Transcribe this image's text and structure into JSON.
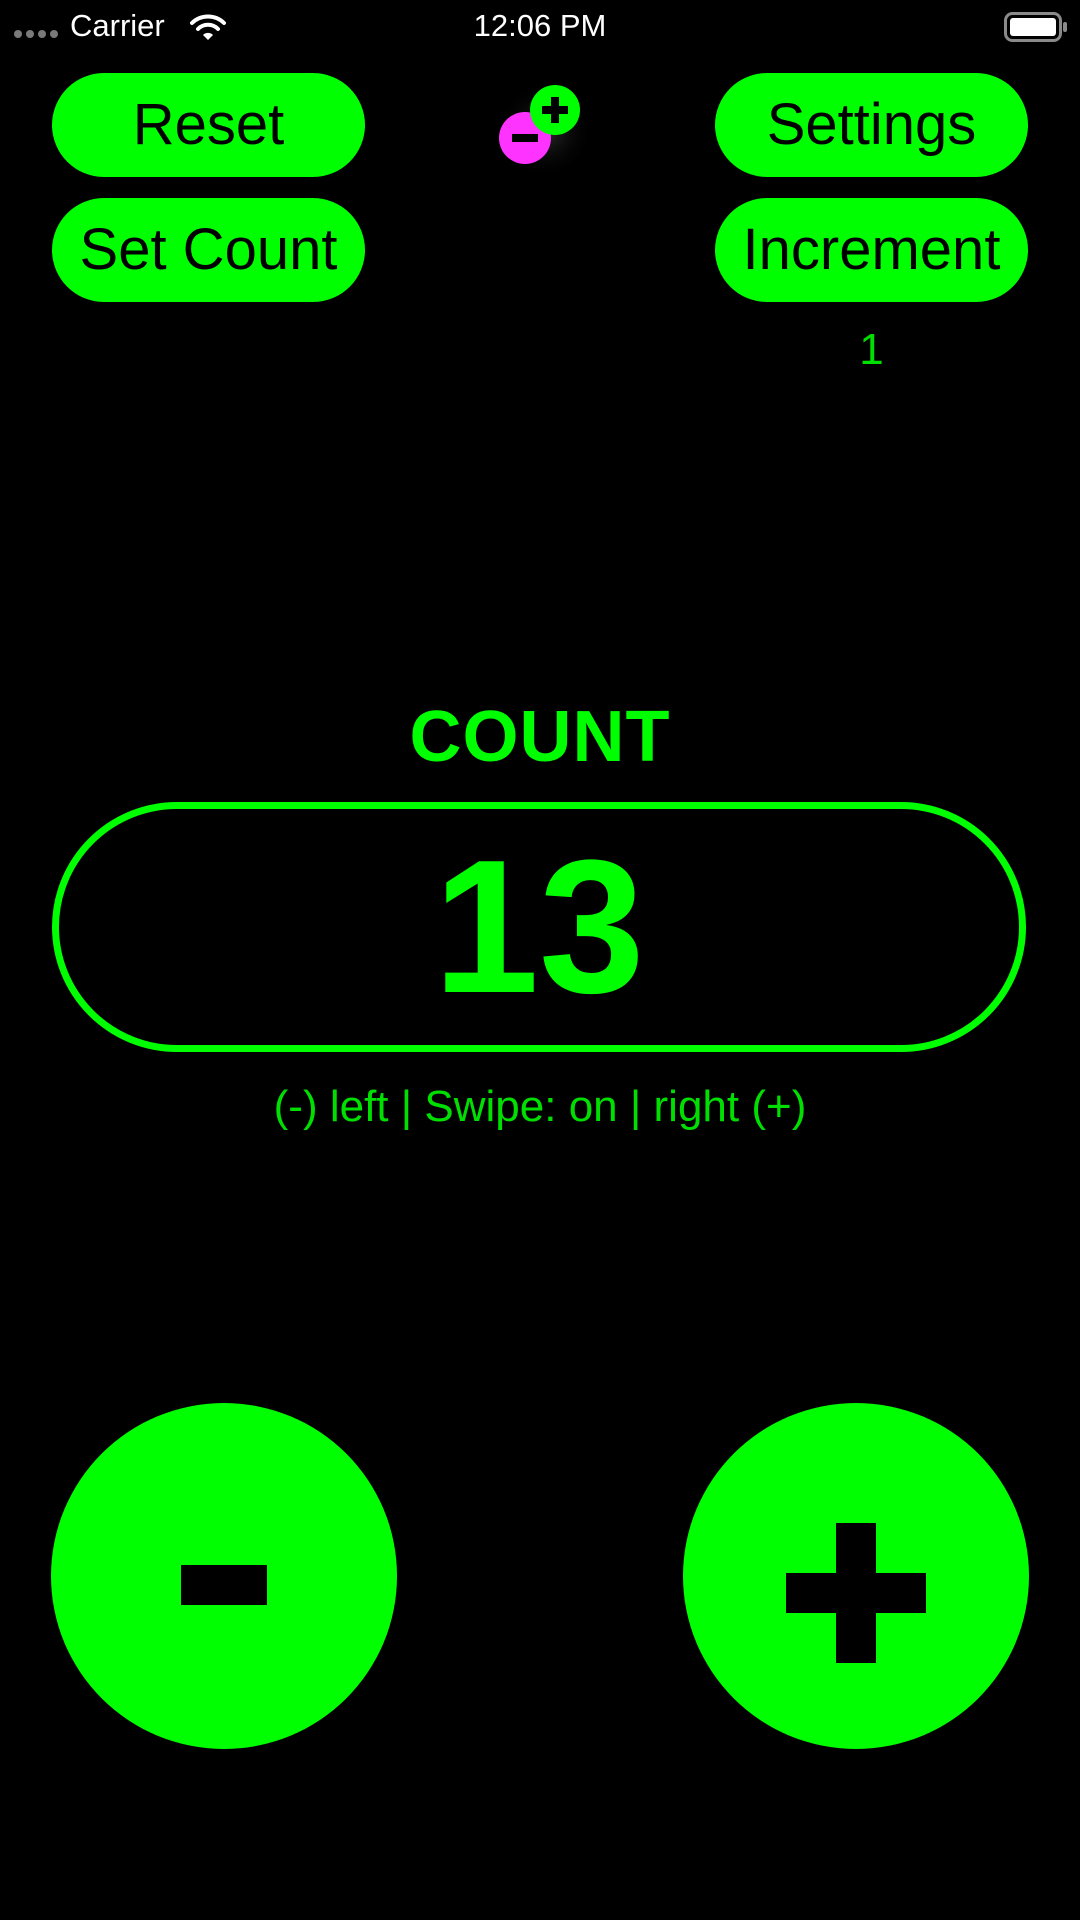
{
  "status_bar": {
    "carrier": "Carrier",
    "time": "12:06 PM",
    "icons": [
      "signal-dots-icon",
      "wifi-icon",
      "battery-icon"
    ]
  },
  "toolbar": {
    "reset_label": "Reset",
    "set_count_label": "Set Count",
    "settings_label": "Settings",
    "increment_label": "Increment",
    "increment_value": "1",
    "logo_icon": "plus-minus-logo-icon"
  },
  "counter": {
    "label": "COUNT",
    "value": "13",
    "swipe_hint": "(-) left | Swipe: on | right (+)"
  },
  "controls": {
    "minus_icon": "minus-icon",
    "plus_icon": "plus-icon"
  },
  "colors": {
    "background": "#000000",
    "accent": "#00FF00",
    "logo_minus": "#FF33FF",
    "button_text": "#000000"
  }
}
